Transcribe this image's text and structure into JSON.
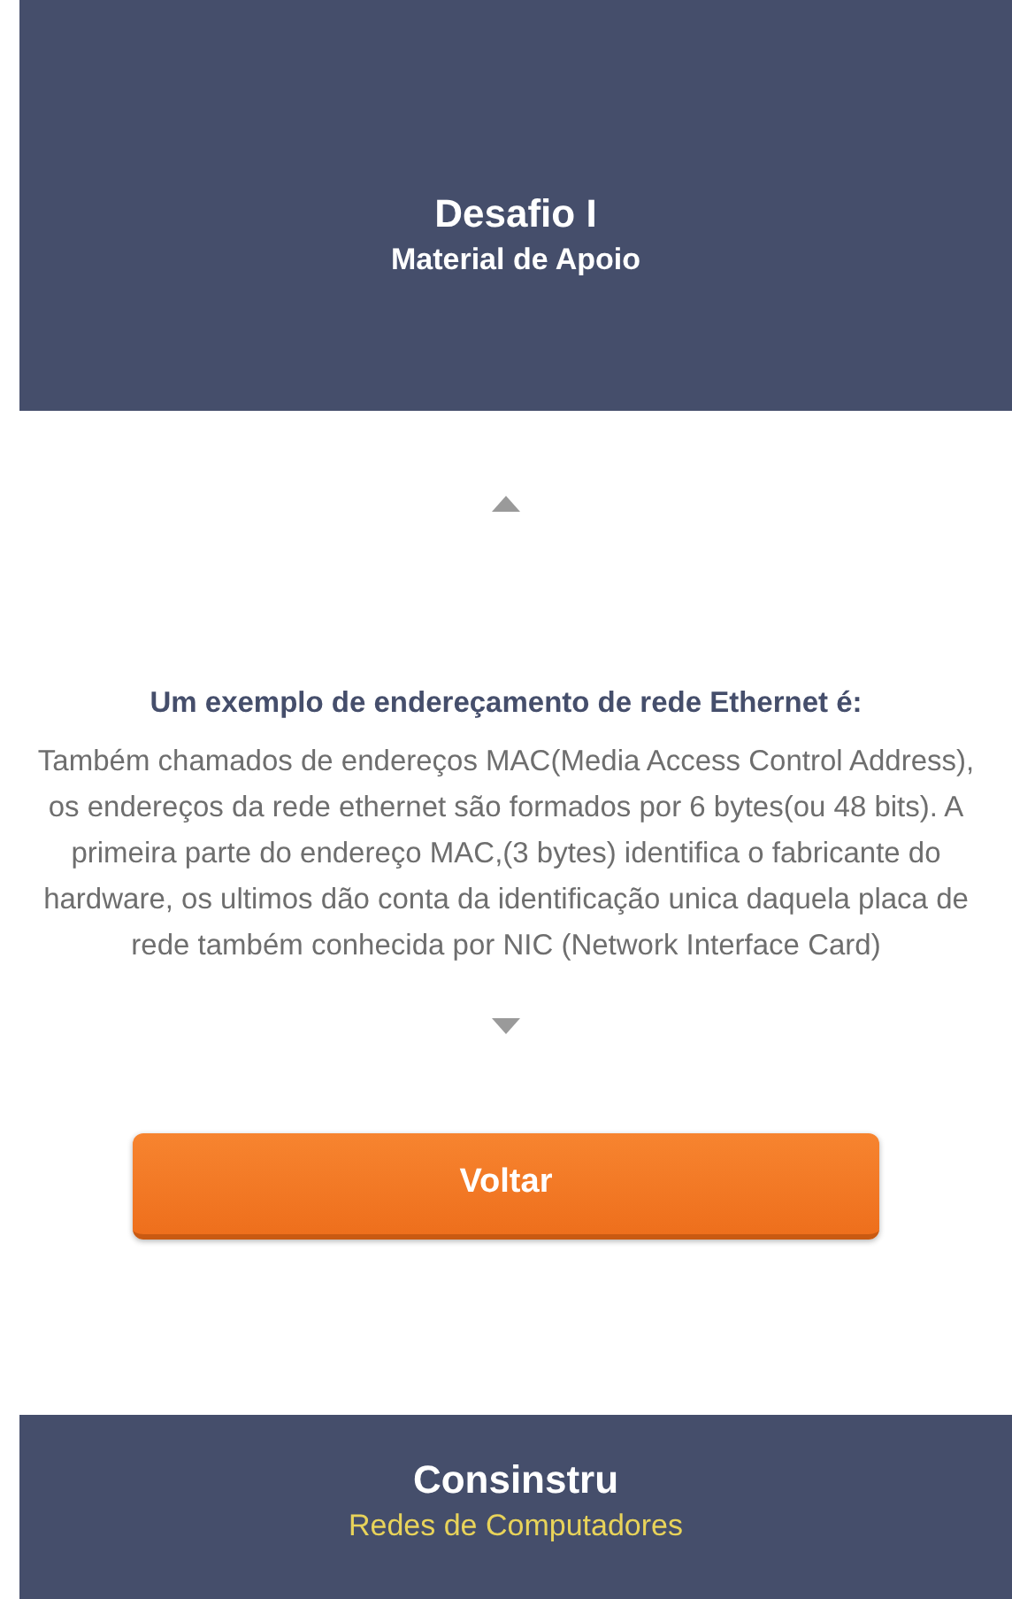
{
  "header": {
    "title": "Desafio I",
    "subtitle": "Material de Apoio"
  },
  "content": {
    "heading": "Um exemplo de endereçamento de rede Ethernet é:",
    "text": "Também chamados de endereços MAC(Media Access Control Address), os endereços da rede ethernet são formados por 6 bytes(ou 48 bits). A primeira parte do endereço MAC,(3 bytes) identifica o fabricante do hardware, os ultimos dão conta da identificação unica daquela placa de rede também conhecida por NIC (Network Interface Card)"
  },
  "buttons": [
    "Voltar"
  ],
  "footer": {
    "title": "Consinstru",
    "subtitle": "Redes de Computadores"
  }
}
